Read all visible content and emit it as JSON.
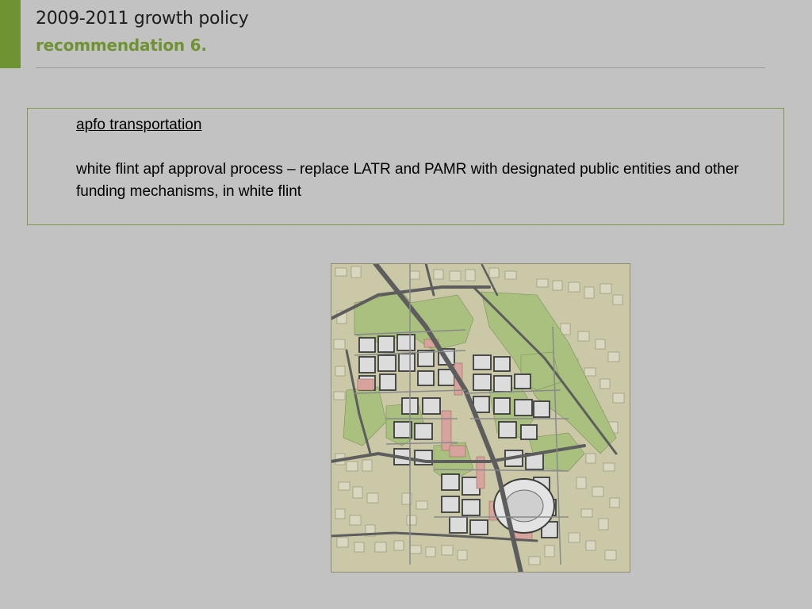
{
  "slide": {
    "title": "2009-2011 growth policy",
    "subtitle": "recommendation 6.",
    "accent_color": "#6f9232",
    "background_color": "#c2c2c2"
  },
  "content": {
    "heading": "apfo transportation",
    "body": "white flint apf approval process – replace LATR and PAMR with designated public entities and other funding mechanisms, in white flint"
  },
  "map": {
    "description_icon": "site-plan-map-image",
    "colors": {
      "land": "#c9c7a6",
      "park": "#a9c07e",
      "road": "#5d5d5d",
      "block_dark": "#4a4a4a",
      "building": "#d9d9d9",
      "accent_pink": "#d7a39c"
    }
  }
}
